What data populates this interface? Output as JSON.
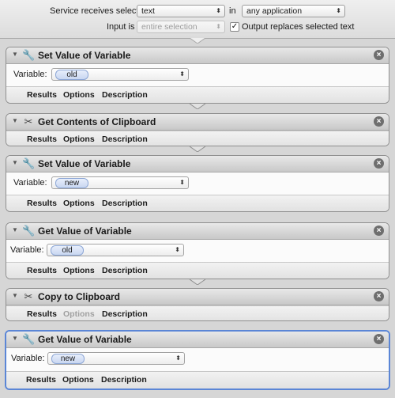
{
  "header": {
    "service_label": "Service receives selected",
    "service_value": "text",
    "in_label": "in",
    "in_value": "any application",
    "input_label": "Input is",
    "input_value": "entire selection",
    "output_checked": "✓",
    "output_label": "Output replaces selected text"
  },
  "tabs": {
    "results": "Results",
    "options": "Options",
    "description": "Description"
  },
  "variable_label": "Variable:",
  "actions": [
    {
      "title": "Set Value of Variable",
      "variable": "old"
    },
    {
      "title": "Get Contents of Clipboard"
    },
    {
      "title": "Set Value of Variable",
      "variable": "new"
    },
    {
      "title": "Get Value of Variable",
      "variable": "old"
    },
    {
      "title": "Copy to Clipboard"
    },
    {
      "title": "Get Value of Variable",
      "variable": "new"
    }
  ],
  "icons": {
    "variable_action": "wrench-icon",
    "clipboard_action": "scissors-icon",
    "close": "close-icon",
    "disclosure": "disclosure-triangle-icon"
  },
  "colors": {
    "selection_border": "#5b86d6",
    "token_fill": "#c9d7f1"
  }
}
